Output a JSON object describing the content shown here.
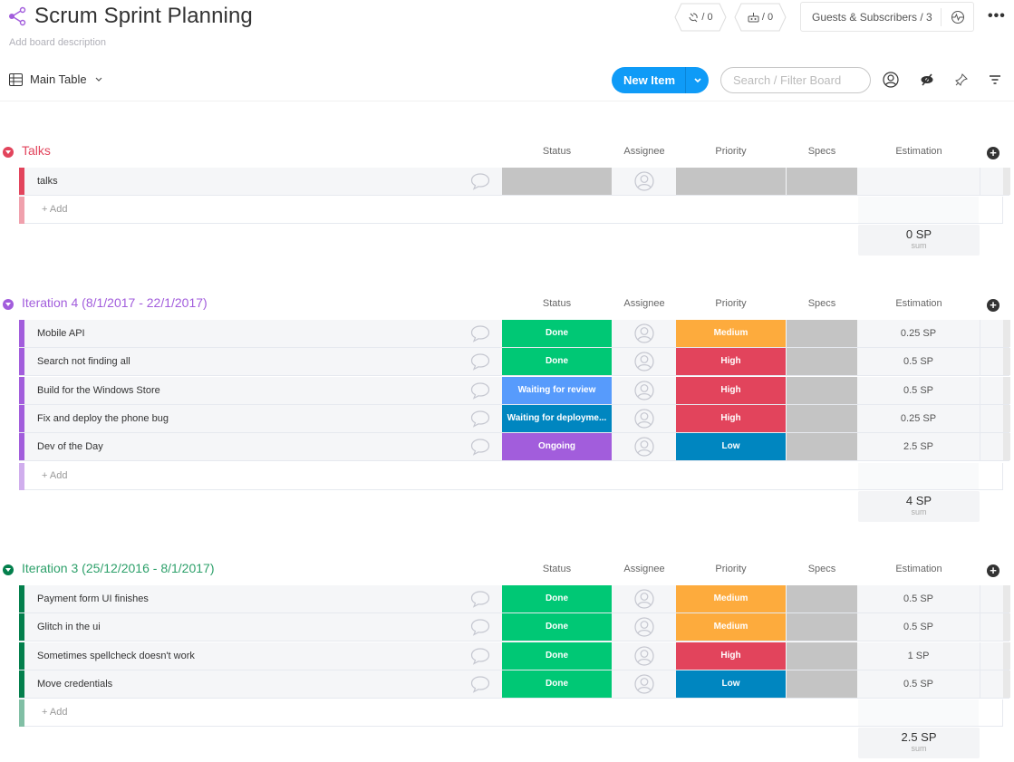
{
  "header": {
    "title": "Scrum Sprint Planning",
    "description_placeholder": "Add board description",
    "integrations_count": "/ 0",
    "automations_count": "/ 0",
    "guests_label": "Guests & Subscribers / 3",
    "more_label": "•••"
  },
  "toolbar": {
    "view_name": "Main Table",
    "new_item_label": "New Item",
    "search_placeholder": "Search / Filter Board"
  },
  "columns": {
    "status": "Status",
    "assignee": "Assignee",
    "priority": "Priority",
    "specs": "Specs",
    "estimation": "Estimation"
  },
  "colors": {
    "done": "#00c875",
    "waiting_review": "#579bfc",
    "waiting_deploy": "#0086c0",
    "ongoing": "#a25ddc",
    "medium": "#fdab3d",
    "high": "#e2445c",
    "low": "#0086c0",
    "empty": "#c4c4c4",
    "accent": "#0f9bf7"
  },
  "groups": [
    {
      "title": "Talks",
      "color": "#e2445c",
      "light": "#f0a1ad",
      "add_label": "+ Add",
      "sum_value": "0 SP",
      "sum_label": "sum",
      "items": [
        {
          "name": "talks",
          "status": "",
          "status_color": "#c4c4c4",
          "priority": "",
          "priority_color": "#c4c4c4",
          "estimation": ""
        }
      ]
    },
    {
      "title": "Iteration 4 (8/1/2017 - 22/1/2017)",
      "color": "#a25ddc",
      "light": "#d0aeed",
      "add_label": "+ Add",
      "sum_value": "4 SP",
      "sum_label": "sum",
      "items": [
        {
          "name": "Mobile API",
          "status": "Done",
          "status_color": "#00c875",
          "priority": "Medium",
          "priority_color": "#fdab3d",
          "estimation": "0.25 SP"
        },
        {
          "name": "Search not finding all",
          "status": "Done",
          "status_color": "#00c875",
          "priority": "High",
          "priority_color": "#e2445c",
          "estimation": "0.5 SP"
        },
        {
          "name": "Build for the Windows Store",
          "status": "Waiting for review",
          "status_color": "#579bfc",
          "priority": "High",
          "priority_color": "#e2445c",
          "estimation": "0.5 SP"
        },
        {
          "name": "Fix and deploy the phone bug",
          "status": "Waiting for deployme...",
          "status_color": "#0086c0",
          "priority": "High",
          "priority_color": "#e2445c",
          "estimation": "0.25 SP"
        },
        {
          "name": "Dev of the Day",
          "status": "Ongoing",
          "status_color": "#a25ddc",
          "priority": "Low",
          "priority_color": "#0086c0",
          "estimation": "2.5 SP"
        }
      ]
    },
    {
      "title": "Iteration 3 (25/12/2016 - 8/1/2017)",
      "color": "#037f4c",
      "light": "#81bfa5",
      "title_color": "#2da06a",
      "add_label": "+ Add",
      "sum_value": "2.5 SP",
      "sum_label": "sum",
      "items": [
        {
          "name": "Payment form UI finishes",
          "status": "Done",
          "status_color": "#00c875",
          "priority": "Medium",
          "priority_color": "#fdab3d",
          "estimation": "0.5 SP"
        },
        {
          "name": "Glitch in the ui",
          "status": "Done",
          "status_color": "#00c875",
          "priority": "Medium",
          "priority_color": "#fdab3d",
          "estimation": "0.5 SP"
        },
        {
          "name": "Sometimes spellcheck doesn't work",
          "status": "Done",
          "status_color": "#00c875",
          "priority": "High",
          "priority_color": "#e2445c",
          "estimation": "1 SP"
        },
        {
          "name": "Move credentials",
          "status": "Done",
          "status_color": "#00c875",
          "priority": "Low",
          "priority_color": "#0086c0",
          "estimation": "0.5 SP"
        }
      ]
    }
  ]
}
